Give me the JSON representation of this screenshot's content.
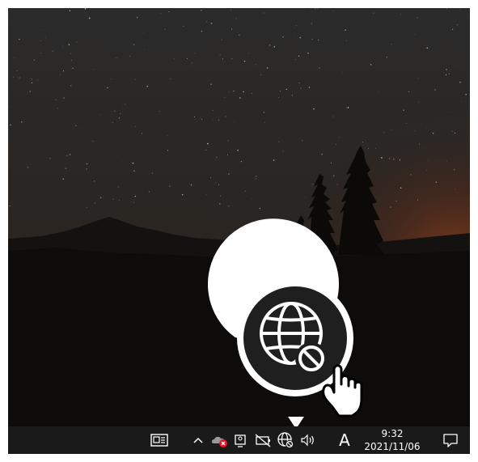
{
  "taskbar": {
    "clock": {
      "time": "9:32",
      "date": "2021/11/06"
    },
    "ime_indicator": "A",
    "tray_icons": [
      "news-and-interests-icon",
      "show-hidden-icons-chevron",
      "onedrive-error-icon",
      "meet-now-icon",
      "battery-unavailable-icon",
      "network-no-internet-icon",
      "volume-icon",
      "ime-mode-icon",
      "notifications-icon"
    ]
  },
  "callout": {
    "icon": "network-no-internet-icon",
    "pointer": "hand-pointer-icon"
  },
  "colors": {
    "taskbar": "#1a1a1a",
    "callout_fill": "#1f1f1f",
    "callout_ring": "#ffffff",
    "icon": "#ffffff",
    "onedrive_error": "#e81123"
  }
}
